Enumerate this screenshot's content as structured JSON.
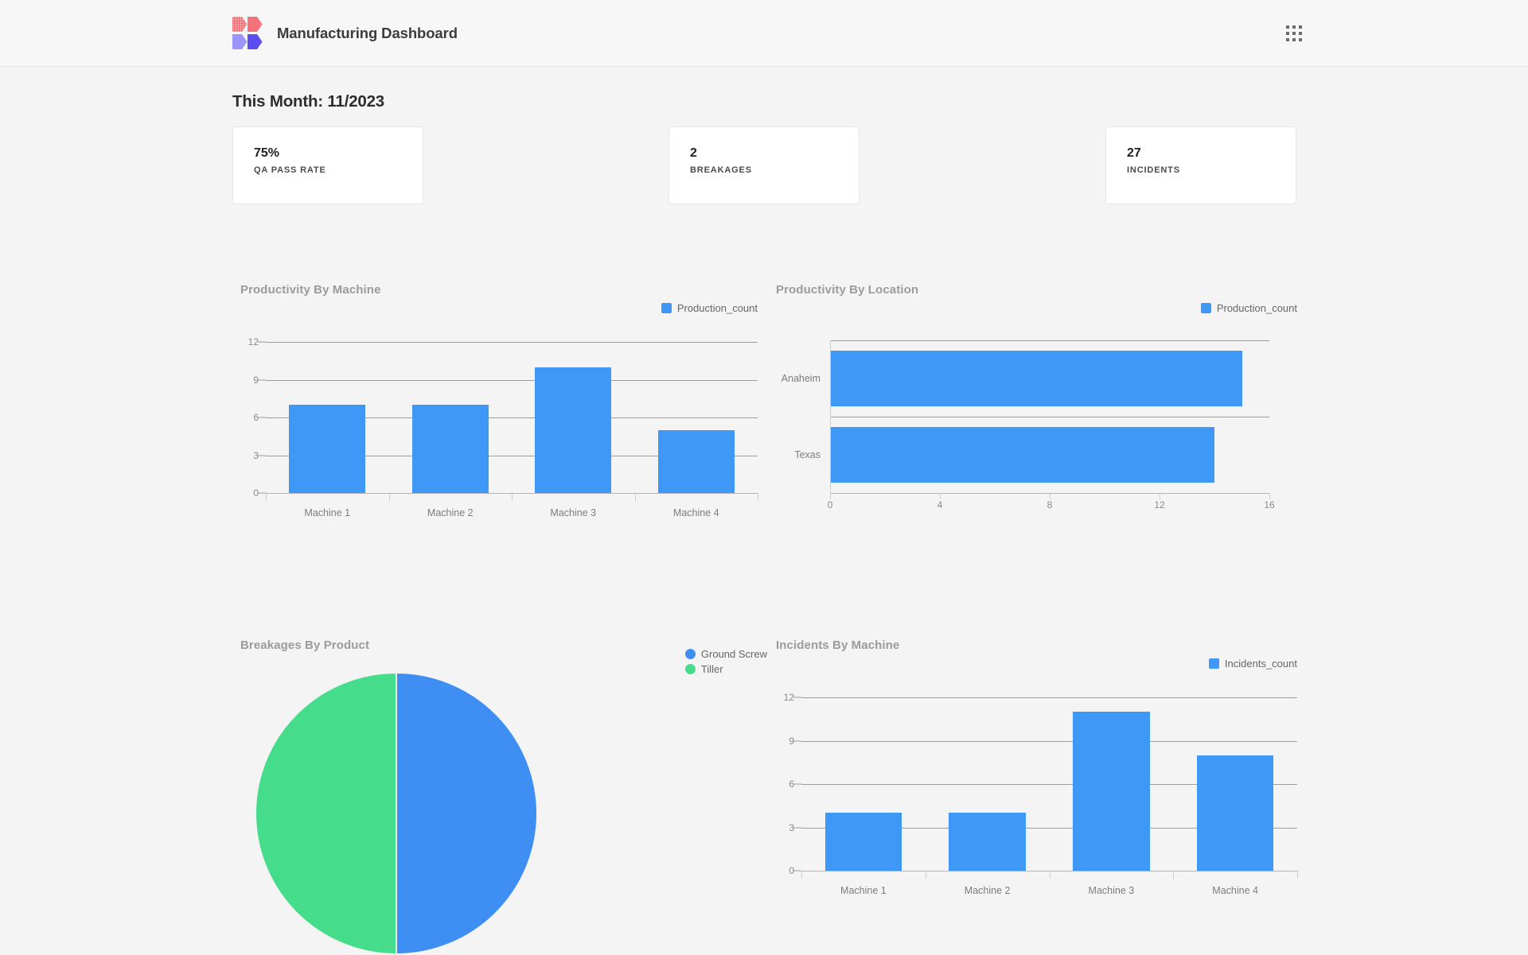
{
  "header": {
    "brand_title": "Manufacturing Dashboard",
    "logo_icon": "logo-arrows-icon",
    "apps_icon": "apps-grid-icon"
  },
  "page": {
    "title": "This Month: 11/2023"
  },
  "kpis": [
    {
      "value": "75%",
      "label": "QA PASS RATE"
    },
    {
      "value": "2",
      "label": "BREAKAGES"
    },
    {
      "value": "27",
      "label": "INCIDENTS"
    }
  ],
  "colors": {
    "bar_blue": "#3f97f6",
    "pie_blue": "#3f8ef3",
    "pie_green": "#45dd8c",
    "page_bg": "#f4f4f4",
    "card_bg": "#ffffff",
    "title_gray": "#9b9b9b"
  },
  "chart_data": [
    {
      "id": "productivity-by-machine",
      "type": "bar",
      "title": "Productivity By Machine",
      "orientation": "vertical",
      "categories": [
        "Machine 1",
        "Machine 2",
        "Machine 3",
        "Machine 4"
      ],
      "series": [
        {
          "name": "Production_count",
          "values": [
            7,
            7,
            10,
            5
          ],
          "color": "#3f97f6"
        }
      ],
      "xlabel": "",
      "ylabel": "",
      "ylim": [
        0,
        12
      ],
      "yticks": [
        0,
        3,
        6,
        9,
        12
      ],
      "grid": true,
      "legend_position": "top-right"
    },
    {
      "id": "productivity-by-location",
      "type": "bar",
      "title": "Productivity By Location",
      "orientation": "horizontal",
      "categories": [
        "Anaheim",
        "Texas"
      ],
      "series": [
        {
          "name": "Production_count",
          "values": [
            15,
            14
          ],
          "color": "#3f97f6"
        }
      ],
      "xlabel": "",
      "ylabel": "",
      "xlim": [
        0,
        16
      ],
      "xticks": [
        0,
        4,
        8,
        12,
        16
      ],
      "grid": true,
      "legend_position": "top-right"
    },
    {
      "id": "breakages-by-product",
      "type": "pie",
      "title": "Breakages By Product",
      "labels": [
        "Ground Screw",
        "Tiller"
      ],
      "values": [
        1,
        1
      ],
      "percentages": [
        50,
        50
      ],
      "colors": [
        "#3f8ef3",
        "#45dd8c"
      ],
      "legend_position": "top-right"
    },
    {
      "id": "incidents-by-machine",
      "type": "bar",
      "title": "Incidents By Machine",
      "orientation": "vertical",
      "categories": [
        "Machine 1",
        "Machine 2",
        "Machine 3",
        "Machine 4"
      ],
      "series": [
        {
          "name": "Incidents_count",
          "values": [
            4,
            4,
            11,
            8
          ],
          "color": "#3f97f6"
        }
      ],
      "xlabel": "",
      "ylabel": "",
      "ylim": [
        0,
        12
      ],
      "yticks": [
        0,
        3,
        6,
        9,
        12
      ],
      "grid": true,
      "legend_position": "top-right"
    }
  ]
}
